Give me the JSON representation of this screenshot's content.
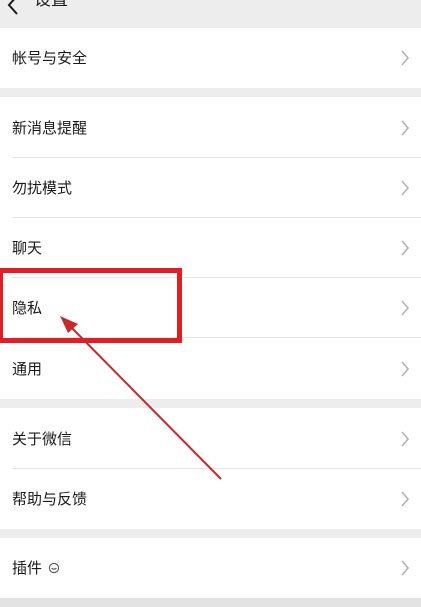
{
  "header": {
    "title": "设置",
    "back_icon": "chevron-left-icon"
  },
  "settings_groups": [
    {
      "items": [
        {
          "label": "帐号与安全",
          "icon": "chevron-right-icon"
        }
      ]
    },
    {
      "items": [
        {
          "label": "新消息提醒",
          "icon": "chevron-right-icon"
        },
        {
          "label": "勿扰模式",
          "icon": "chevron-right-icon"
        },
        {
          "label": "聊天",
          "icon": "chevron-right-icon"
        },
        {
          "label": "隐私",
          "icon": "chevron-right-icon"
        },
        {
          "label": "通用",
          "icon": "chevron-right-icon"
        }
      ]
    },
    {
      "items": [
        {
          "label": "关于微信",
          "icon": "chevron-right-icon"
        },
        {
          "label": "帮助与反馈",
          "icon": "chevron-right-icon"
        }
      ]
    },
    {
      "items": [
        {
          "label": "插件",
          "icon": "chevron-right-icon",
          "badge_icon": "plugin-status-icon"
        }
      ]
    }
  ],
  "annotation": {
    "highlight_color": "#e01e24",
    "arrow_color": "#c62b2b",
    "highlighted_item": "隐私"
  },
  "colors": {
    "background": "#ededed",
    "row_background": "#ffffff",
    "text": "#1a1a1a",
    "chevron": "#b2b2b2"
  }
}
